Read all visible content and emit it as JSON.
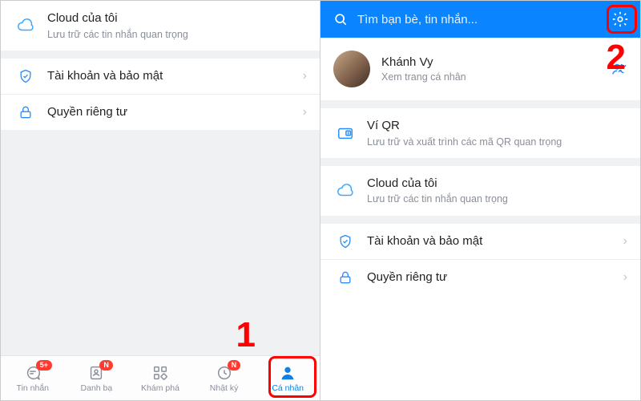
{
  "colors": {
    "accent": "#1081e0",
    "header": "#0a84ff",
    "muted": "#8a8f98",
    "danger": "#ff3b30"
  },
  "left": {
    "cloud": {
      "title": "Cloud của tôi",
      "sub": "Lưu trữ các tin nhắn quan trọng"
    },
    "account": {
      "title": "Tài khoản và bảo mật"
    },
    "privacy": {
      "title": "Quyền riêng tư"
    },
    "tabs": {
      "messages": {
        "label": "Tin nhắn",
        "badge": "5+"
      },
      "contacts": {
        "label": "Danh bạ",
        "badge": "N"
      },
      "discover": {
        "label": "Khám phá"
      },
      "diary": {
        "label": "Nhật ký",
        "badge": "N"
      },
      "me": {
        "label": "Cá nhân"
      }
    }
  },
  "right": {
    "search_placeholder": "Tìm bạn bè, tin nhắn...",
    "profile": {
      "name": "Khánh Vy",
      "sub": "Xem trang cá nhân"
    },
    "qr": {
      "title": "Ví QR",
      "sub": "Lưu trữ và xuất trình các mã QR quan trọng"
    },
    "cloud": {
      "title": "Cloud của tôi",
      "sub": "Lưu trữ các tin nhắn quan trọng"
    },
    "account": {
      "title": "Tài khoản và bảo mật"
    },
    "privacy": {
      "title": "Quyền riêng tư"
    }
  },
  "annotations": {
    "one": "1",
    "two": "2"
  }
}
